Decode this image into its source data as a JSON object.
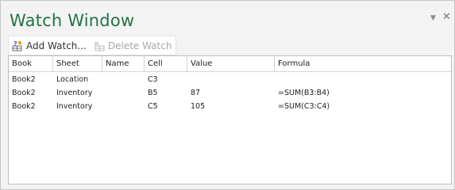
{
  "pane": {
    "title": "Watch Window",
    "dropdown_glyph": "▼",
    "close_glyph": "✕"
  },
  "toolbar": {
    "add_label": "Add Watch...",
    "add_icon": "add-watch-icon",
    "delete_label": "Delete Watch",
    "delete_icon": "delete-watch-icon"
  },
  "grid": {
    "columns": [
      "Book",
      "Sheet",
      "Name",
      "Cell",
      "Value",
      "Formula"
    ],
    "rows": [
      {
        "book": "Book2",
        "sheet": "Location",
        "name": "",
        "cell": "C3",
        "value": "",
        "formula": ""
      },
      {
        "book": "Book2",
        "sheet": "Inventory",
        "name": "",
        "cell": "B5",
        "value": "87",
        "formula": "=SUM(B3:B4)"
      },
      {
        "book": "Book2",
        "sheet": "Inventory",
        "name": "",
        "cell": "C5",
        "value": "105",
        "formula": "=SUM(C3:C4)"
      }
    ]
  },
  "colors": {
    "accent": "#217346",
    "disabled_text": "#a8a8a8"
  }
}
